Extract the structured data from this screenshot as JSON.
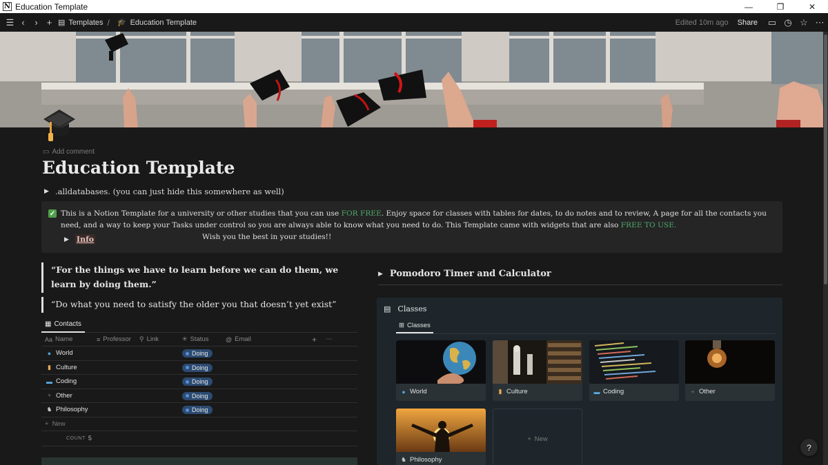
{
  "window": {
    "title": "Education Template",
    "app_icon": "N"
  },
  "topbar": {
    "breadcrumbs": [
      {
        "label": "Templates",
        "icon": "folder-icon"
      },
      {
        "label": "Education Template",
        "icon": "graduation-cap-icon"
      }
    ],
    "edited": "Edited 10m ago",
    "share_label": "Share"
  },
  "page": {
    "title": "Education Template",
    "add_comment": "Add comment",
    "toggle_alldb": ".alldatabases. (you can just hide this somewhere as well)",
    "callout": {
      "part1": "This is a Notion Template for a university or other studies that you can use ",
      "free1": "FOR FREE",
      "part2": ". Enjoy space for classes with tables for dates, to do notes and to review, A page for all the contacts you need, and a way to keep your Tasks under control so you are always able to know what you need to do. This Template came with widgets that are also ",
      "free2": "FREE TO USE.",
      "part3": "Wish you the best in your studies!!",
      "info_label": "Info"
    },
    "quote1": "“For the things we have to learn before we can do them, we learn by doing them.”",
    "quote2": "“Do what you need to satisfy the older you that doesn’t yet exist”"
  },
  "contacts": {
    "tab_label": "Contacts",
    "columns": [
      "Name",
      "Professor",
      "Link",
      "Status",
      "Email"
    ],
    "rows": [
      {
        "name": "World",
        "icon": "globe-icon",
        "status": "Doing"
      },
      {
        "name": "Culture",
        "icon": "scroll-icon",
        "status": "Doing"
      },
      {
        "name": "Coding",
        "icon": "laptop-icon",
        "status": "Doing"
      },
      {
        "name": "Other",
        "icon": "plus-icon",
        "status": "Doing"
      },
      {
        "name": "Philosophy",
        "icon": "thinker-icon",
        "status": "Doing"
      }
    ],
    "new_label": "New",
    "count_label": "COUNT",
    "count_value": "5"
  },
  "pomodoro": {
    "label": "Pomodoro Timer and Calculator"
  },
  "classes": {
    "title": "Classes",
    "tab_label": "Classes",
    "cards": [
      {
        "label": "World",
        "icon": "globe-icon"
      },
      {
        "label": "Culture",
        "icon": "scroll-icon"
      },
      {
        "label": "Coding",
        "icon": "laptop-icon"
      },
      {
        "label": "Other",
        "icon": "plus-icon"
      },
      {
        "label": "Philosophy",
        "icon": "thinker-icon"
      }
    ],
    "new_label": "New"
  },
  "help_label": "?",
  "colors": {
    "background": "#191919",
    "status_blue": "#2c4b72",
    "green_text": "#4fa86b",
    "callout_bg": "#252525",
    "classes_bg": "#1e262b"
  }
}
